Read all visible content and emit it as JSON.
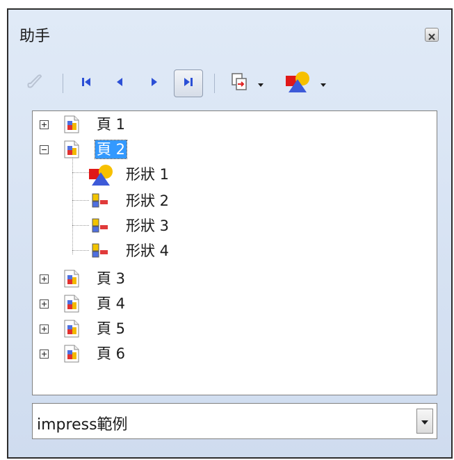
{
  "window": {
    "title": "助手",
    "close_icon": "close-icon"
  },
  "toolbar": {
    "buttons": [
      {
        "name": "drag-mode-button",
        "icon": "pen-icon",
        "enabled": false
      },
      {
        "name": "first-slide-button",
        "icon": "first-icon",
        "enabled": true
      },
      {
        "name": "previous-slide-button",
        "icon": "previous-icon",
        "enabled": true
      },
      {
        "name": "next-slide-button",
        "icon": "next-icon",
        "enabled": true
      },
      {
        "name": "last-slide-button",
        "icon": "last-icon",
        "enabled": true,
        "pressed": true
      },
      {
        "name": "drag-mode-dropdown",
        "icon": "insert-link-icon",
        "enabled": true
      },
      {
        "name": "show-shapes-dropdown",
        "icon": "shapes-icon",
        "enabled": true
      }
    ]
  },
  "tree": {
    "pages": [
      {
        "label": "頁 1",
        "expanded": false
      },
      {
        "label": "頁 2",
        "expanded": true,
        "selected": true,
        "children": [
          {
            "label": "形狀 1",
            "icon": "shapes-icon"
          },
          {
            "label": "形狀 2",
            "icon": "object-icon"
          },
          {
            "label": "形狀 3",
            "icon": "object-icon"
          },
          {
            "label": "形狀 4",
            "icon": "object-icon"
          }
        ]
      },
      {
        "label": "頁 3",
        "expanded": false
      },
      {
        "label": "頁 4",
        "expanded": false
      },
      {
        "label": "頁 5",
        "expanded": false
      },
      {
        "label": "頁 6",
        "expanded": false
      }
    ]
  },
  "document_select": {
    "value": "impress範例"
  },
  "colors": {
    "selection": "#3399ff",
    "nav_arrow": "#2b4fd6",
    "shape_red": "#e02020",
    "shape_yellow": "#f5c000",
    "shape_blue": "#3d5ad8"
  }
}
